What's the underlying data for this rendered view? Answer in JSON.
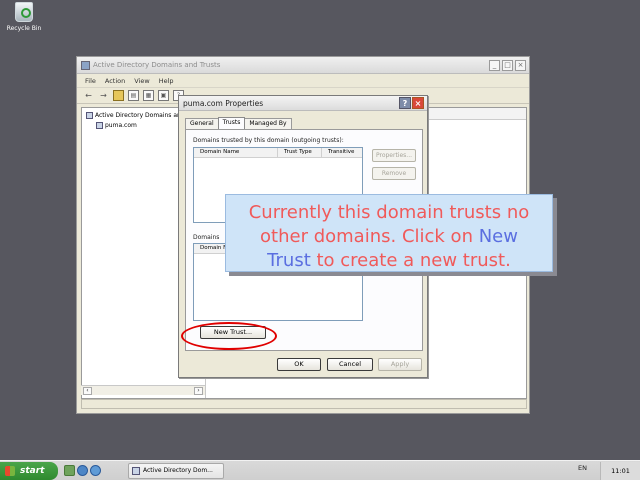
{
  "desktop": {
    "recycle_bin_label": "Recycle Bin"
  },
  "main_window": {
    "title": "Active Directory Domains and Trusts",
    "menu": [
      "File",
      "Action",
      "View",
      "Help"
    ],
    "tree": {
      "root": "Active Directory Domains an",
      "child": "puma.com"
    }
  },
  "dialog": {
    "title": "puma.com Properties",
    "tabs": [
      "General",
      "Trusts",
      "Managed By"
    ],
    "active_tab": "Trusts",
    "outgoing_label": "Domains trusted by this domain (outgoing trusts):",
    "columns": [
      "Domain Name",
      "Trust Type",
      "Transitive"
    ],
    "properties_button": "Properties...",
    "remove_button": "Remove",
    "incoming_label": "Domains",
    "incoming_column": "Domain N",
    "new_trust_button": "New Trust...",
    "ok_button": "OK",
    "cancel_button": "Cancel",
    "apply_button": "Apply"
  },
  "callout": {
    "part1": "Currently this domain trusts no other domains. Click on ",
    "keyword": "New Trust",
    "part2": " to create a new trust."
  },
  "taskbar": {
    "start_label": "start",
    "task_label": "Active Directory Dom...",
    "language": "EN",
    "clock": "11:01"
  },
  "colors": {
    "desktop": "#57575f",
    "callout_text": "#f05a5a",
    "callout_keyword": "#5a6ee0",
    "callout_bg": "#cfe4f8",
    "highlight_ellipse": "#e00000",
    "start_button": "#3a9a3a"
  }
}
